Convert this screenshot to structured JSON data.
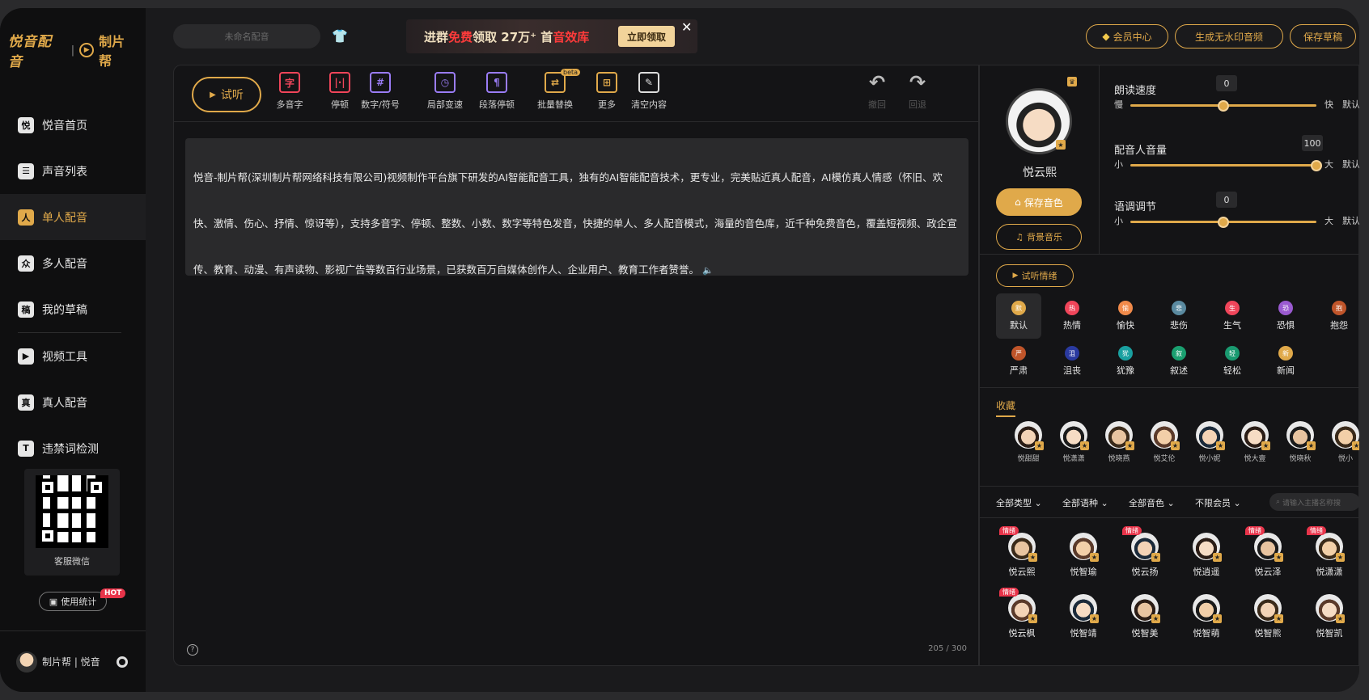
{
  "brand": {
    "name": "悦音配音",
    "partner": "制片帮"
  },
  "nav": [
    {
      "label": "悦音首页",
      "icon": "home-icon",
      "glyph": "悦"
    },
    {
      "label": "声音列表",
      "icon": "list-icon",
      "glyph": "☰"
    },
    {
      "label": "单人配音",
      "icon": "single-person-icon",
      "glyph": "人",
      "active": true
    },
    {
      "label": "多人配音",
      "icon": "multi-person-icon",
      "glyph": "众"
    },
    {
      "label": "我的草稿",
      "icon": "draft-icon",
      "glyph": "稿"
    },
    {
      "label": "视频工具",
      "icon": "video-icon",
      "glyph": "▶"
    },
    {
      "label": "真人配音",
      "icon": "person-icon",
      "glyph": "真"
    },
    {
      "label": "违禁词检测",
      "icon": "shield-icon",
      "glyph": "T"
    }
  ],
  "qr": {
    "label": "客服微信"
  },
  "stats": {
    "label": "使用统计",
    "badge": "HOT"
  },
  "user": {
    "name": "制片帮 | 悦音"
  },
  "topbar": {
    "project_placeholder": "未命名配音",
    "promo": {
      "part1": "进群",
      "part2": "免费",
      "part3": "领取 27万⁺ 首",
      "part4": "音效库",
      "button": "立即领取"
    },
    "member_center": "会员中心",
    "generate_audio": "生成无水印音频",
    "save_draft": "保存草稿"
  },
  "toolbar": {
    "listen": "试听",
    "tools": [
      {
        "label": "多音字",
        "icon": "polyphone-icon",
        "glyph": "字",
        "color": "red"
      },
      {
        "label": "停顿",
        "icon": "pause-icon",
        "glyph": "|·|",
        "color": "red"
      },
      {
        "label": "数字/符号",
        "icon": "hash-icon",
        "glyph": "#",
        "color": "purple"
      },
      {
        "label": "局部变速",
        "icon": "speed-icon",
        "glyph": "◷",
        "color": "purple"
      },
      {
        "label": "段落停顿",
        "icon": "paragraph-pause-icon",
        "glyph": "¶",
        "color": "purple"
      },
      {
        "label": "批量替换",
        "icon": "batch-replace-icon",
        "glyph": "⇄",
        "color": "gold",
        "beta": "beta"
      },
      {
        "label": "更多",
        "icon": "more-icon",
        "glyph": "⊞",
        "color": "gold"
      },
      {
        "label": "清空内容",
        "icon": "clear-icon",
        "glyph": "✎",
        "color": "white"
      }
    ],
    "undo": "撤回",
    "redo": "回退"
  },
  "editor": {
    "text": "悦音-制片帮(深圳制片帮网络科技有限公司)视频制作平台旗下研发的AI智能配音工具，独有的AI智能配音技术，更专业，完美贴近真人配音，AI模仿真人情感（怀旧、欢快、激情、伤心、抒情、惊讶等），支持多音字、停顿、整数、小数、数字等特色发音，快捷的单人、多人配音模式，海量的音色库，近千种免费音色，覆盖短视频、政企宣传、教育、动漫、有声读物、影视广告等数百行业场景，已获数百万自媒体创作人、企业用户、教育工作者赞誉。",
    "counter": "205 / 300"
  },
  "voice": {
    "name": "悦云熙",
    "save": "保存音色",
    "bgm": "背景音乐"
  },
  "sliders": [
    {
      "title": "朗读速度",
      "value": "0",
      "min": "慢",
      "max": "快",
      "extra": "默认",
      "pos": 0.5
    },
    {
      "title": "配音人音量",
      "value": "100",
      "min": "小",
      "max": "大",
      "extra": "默认",
      "pos": 1.0
    },
    {
      "title": "语调调节",
      "value": "0",
      "min": "小",
      "max": "大",
      "extra": "默认",
      "pos": 0.5
    }
  ],
  "emotion_listen": "试听情绪",
  "emotions": [
    {
      "label": "默认",
      "glyph": "默",
      "color": "#e0a94a",
      "active": true
    },
    {
      "label": "热情",
      "glyph": "热",
      "color": "#f0455a"
    },
    {
      "label": "愉快",
      "glyph": "愉",
      "color": "#f08a4a"
    },
    {
      "label": "悲伤",
      "glyph": "悲",
      "color": "#5a8aa0"
    },
    {
      "label": "生气",
      "glyph": "生",
      "color": "#f0455a"
    },
    {
      "label": "恐惧",
      "glyph": "恐",
      "color": "#9a5ad0"
    },
    {
      "label": "抱怨",
      "glyph": "抱",
      "color": "#c0552a"
    },
    {
      "label": "严肃",
      "glyph": "严",
      "color": "#c0552a"
    },
    {
      "label": "沮丧",
      "glyph": "沮",
      "color": "#2a3aa0"
    },
    {
      "label": "犹豫",
      "glyph": "犹",
      "color": "#1aa0a0"
    },
    {
      "label": "叙述",
      "glyph": "叙",
      "color": "#1aa070"
    },
    {
      "label": "轻松",
      "glyph": "轻",
      "color": "#1a9a70"
    },
    {
      "label": "新闻",
      "glyph": "新",
      "color": "#e0a94a"
    }
  ],
  "favorites": {
    "title": "收藏",
    "items": [
      "悦甜甜",
      "悦潇潇",
      "悦晓燕",
      "悦艾伦",
      "悦小妮",
      "悦大壹",
      "悦晓秋",
      "悦小"
    ]
  },
  "filters": {
    "type": "全部类型",
    "language": "全部语种",
    "timbre": "全部音色",
    "member": "不限会员",
    "search_placeholder": "请输入主播名称搜"
  },
  "voices": {
    "tag": "情绪",
    "items": [
      {
        "name": "悦云熙",
        "tag": true
      },
      {
        "name": "悦智瑜",
        "tag": false
      },
      {
        "name": "悦云扬",
        "tag": true
      },
      {
        "name": "悦逍遥",
        "tag": false
      },
      {
        "name": "悦云泽",
        "tag": true
      },
      {
        "name": "悦潇潇",
        "tag": true
      },
      {
        "name": "悦云枫",
        "tag": true
      },
      {
        "name": "悦智靖",
        "tag": false
      },
      {
        "name": "悦智美",
        "tag": false
      },
      {
        "name": "悦智萌",
        "tag": false
      },
      {
        "name": "悦智熊",
        "tag": false
      },
      {
        "name": "悦智凯",
        "tag": false
      }
    ]
  }
}
